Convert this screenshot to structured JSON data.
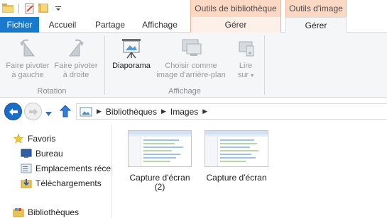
{
  "titlebar": {
    "context_groups": [
      "Outils de bibliothèque",
      "Outils d'image"
    ]
  },
  "tabs": {
    "file": "Fichier",
    "accueil": "Accueil",
    "partage": "Partage",
    "affichage": "Affichage",
    "gerer_biblio": "Gérer",
    "gerer_image": "Gérer"
  },
  "ribbon": {
    "rotate_left": "Faire pivoter\nà gauche",
    "rotate_left_l1": "Faire pivoter",
    "rotate_left_l2": "à gauche",
    "rotate_right_l1": "Faire pivoter",
    "rotate_right_l2": "à droite",
    "slideshow": "Diaporama",
    "set_bg_l1": "Choisir comme",
    "set_bg_l2": "image d'arrière-plan",
    "play_l1": "Lire",
    "play_l2": "sur",
    "group_rotation": "Rotation",
    "group_affichage": "Affichage"
  },
  "address": {
    "crumbs": [
      "Bibliothèques",
      "Images"
    ]
  },
  "navpane": {
    "favoris": "Favoris",
    "bureau": "Bureau",
    "emplacements": "Emplacements récer",
    "telechargements": "Téléchargements",
    "bibliotheques": "Bibliothèques"
  },
  "files": [
    {
      "name_l1": "Capture d'écran",
      "name_l2": "(2)"
    },
    {
      "name_l1": "Capture d'écran",
      "name_l2": ""
    }
  ],
  "colors": {
    "file_tab": "#1979ca",
    "context_tab": "#fbd8c4",
    "back_button": "#1a6ec8"
  }
}
